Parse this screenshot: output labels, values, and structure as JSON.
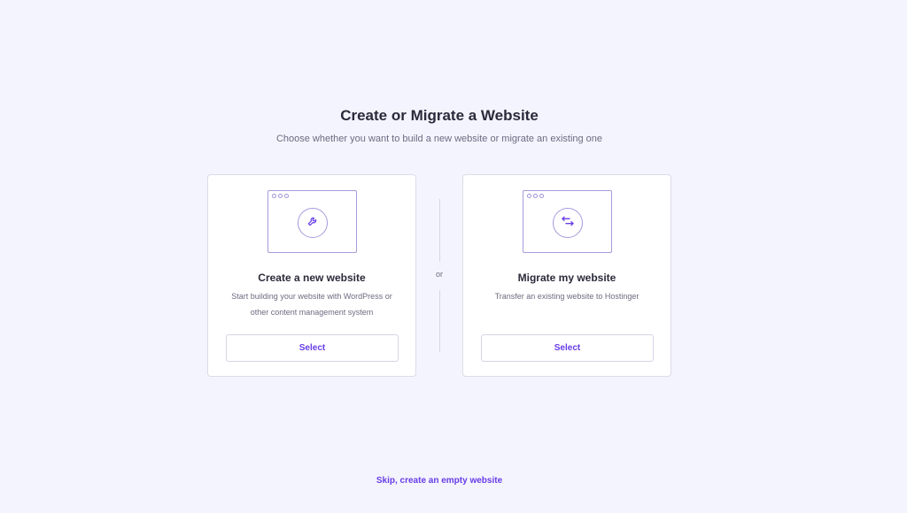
{
  "header": {
    "title": "Create or Migrate a Website",
    "subtitle": "Choose whether you want to build a new website or migrate an existing one"
  },
  "divider": {
    "label": "or"
  },
  "cards": [
    {
      "icon": "wrench-icon",
      "title": "Create a new website",
      "description": "Start building your website with WordPress or other content management system",
      "button_label": "Select"
    },
    {
      "icon": "arrows-swap-icon",
      "title": "Migrate my website",
      "description": "Transfer an existing website to Hostinger",
      "button_label": "Select"
    }
  ],
  "footer": {
    "skip_label": "Skip, create an empty website"
  },
  "colors": {
    "background": "#f4f4ff",
    "accent": "#673de6",
    "illustration_stroke": "#a59bdd",
    "text_primary": "#2b2a3a",
    "text_secondary": "#6d6b80"
  }
}
